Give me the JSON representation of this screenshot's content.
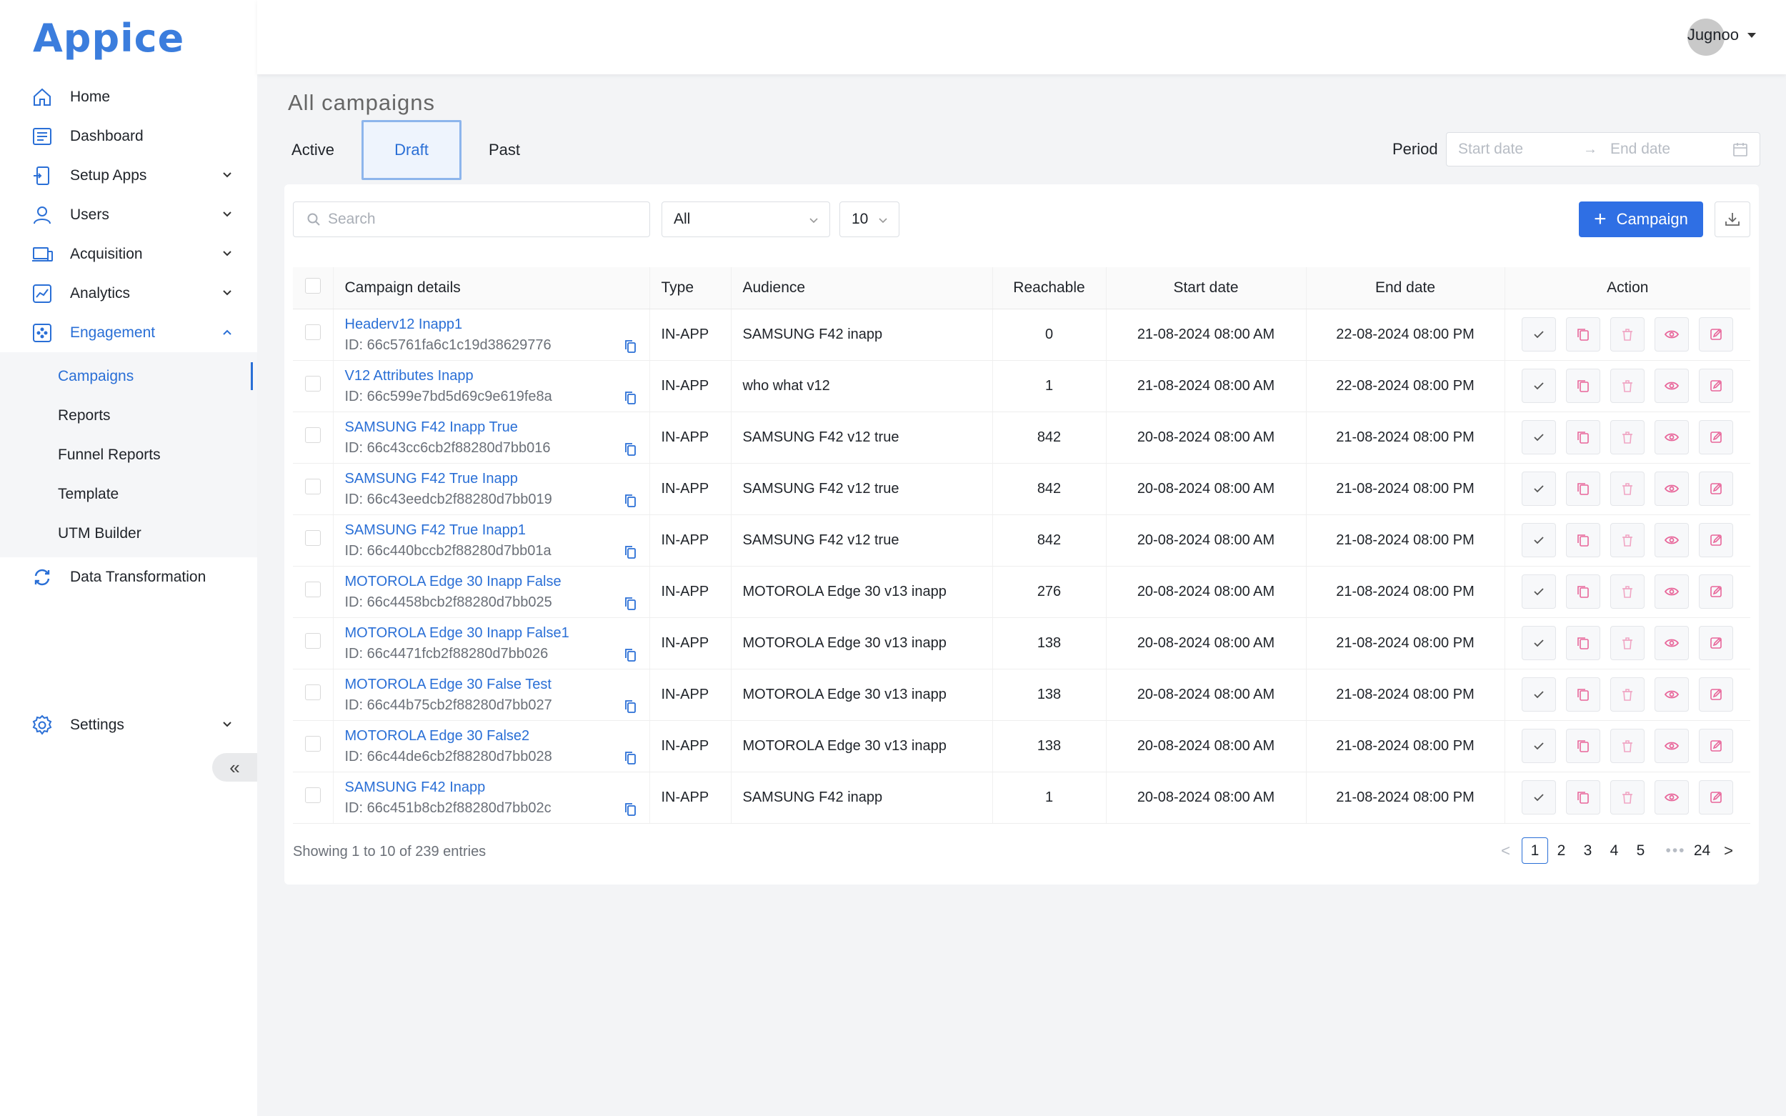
{
  "app": {
    "logo": "Appice"
  },
  "user": {
    "name": "Jugnoo"
  },
  "sidebar": {
    "items": [
      {
        "label": "Home",
        "icon": "home-icon"
      },
      {
        "label": "Dashboard",
        "icon": "dashboard-icon"
      },
      {
        "label": "Setup Apps",
        "icon": "setup-apps-icon"
      },
      {
        "label": "Users",
        "icon": "users-icon"
      },
      {
        "label": "Acquisition",
        "icon": "acquisition-icon"
      },
      {
        "label": "Analytics",
        "icon": "analytics-icon"
      },
      {
        "label": "Engagement",
        "icon": "engagement-icon"
      },
      {
        "label": "Data Transformation",
        "icon": "data-transformation-icon"
      },
      {
        "label": "Settings",
        "icon": "settings-icon"
      }
    ],
    "engagement_sub": [
      "Campaigns",
      "Reports",
      "Funnel Reports",
      "Template",
      "UTM Builder"
    ],
    "collapse_label": "«"
  },
  "page": {
    "title": "All campaigns",
    "tabs": [
      "Active",
      "Draft",
      "Past"
    ],
    "period_label": "Period",
    "start_placeholder": "Start date",
    "end_placeholder": "End date",
    "arrow": "→"
  },
  "toolbar": {
    "search_placeholder": "Search",
    "filter_value": "All",
    "page_size": "10",
    "add_label": "Campaign",
    "add_plus": "+"
  },
  "table": {
    "headers": [
      "Campaign details",
      "Type",
      "Audience",
      "Reachable",
      "Start date",
      "End date",
      "Action"
    ],
    "rows": [
      {
        "name": "Headerv12 Inapp1",
        "id": "ID: 66c5761fa6c1c19d38629776",
        "type": "IN-APP",
        "audience": "SAMSUNG F42 inapp",
        "reachable": "0",
        "start": "21-08-2024 08:00 AM",
        "end": "22-08-2024 08:00 PM"
      },
      {
        "name": "V12 Attributes Inapp",
        "id": "ID: 66c599e7bd5d69c9e619fe8a",
        "type": "IN-APP",
        "audience": "who what v12",
        "reachable": "1",
        "start": "21-08-2024 08:00 AM",
        "end": "22-08-2024 08:00 PM"
      },
      {
        "name": "SAMSUNG F42 Inapp True",
        "id": "ID: 66c43cc6cb2f88280d7bb016",
        "type": "IN-APP",
        "audience": "SAMSUNG F42 v12 true",
        "reachable": "842",
        "start": "20-08-2024 08:00 AM",
        "end": "21-08-2024 08:00 PM"
      },
      {
        "name": "SAMSUNG F42 True Inapp",
        "id": "ID: 66c43eedcb2f88280d7bb019",
        "type": "IN-APP",
        "audience": "SAMSUNG F42 v12 true",
        "reachable": "842",
        "start": "20-08-2024 08:00 AM",
        "end": "21-08-2024 08:00 PM"
      },
      {
        "name": "SAMSUNG F42 True Inapp1",
        "id": "ID: 66c440bccb2f88280d7bb01a",
        "type": "IN-APP",
        "audience": "SAMSUNG F42 v12 true",
        "reachable": "842",
        "start": "20-08-2024 08:00 AM",
        "end": "21-08-2024 08:00 PM"
      },
      {
        "name": "MOTOROLA Edge 30 Inapp False",
        "id": "ID: 66c4458bcb2f88280d7bb025",
        "type": "IN-APP",
        "audience": "MOTOROLA Edge 30 v13 inapp",
        "reachable": "276",
        "start": "20-08-2024 08:00 AM",
        "end": "21-08-2024 08:00 PM"
      },
      {
        "name": "MOTOROLA Edge 30 Inapp False1",
        "id": "ID: 66c4471fcb2f88280d7bb026",
        "type": "IN-APP",
        "audience": "MOTOROLA Edge 30 v13 inapp",
        "reachable": "138",
        "start": "20-08-2024 08:00 AM",
        "end": "21-08-2024 08:00 PM"
      },
      {
        "name": "MOTOROLA Edge 30 False Test",
        "id": "ID: 66c44b75cb2f88280d7bb027",
        "type": "IN-APP",
        "audience": "MOTOROLA Edge 30 v13 inapp",
        "reachable": "138",
        "start": "20-08-2024 08:00 AM",
        "end": "21-08-2024 08:00 PM"
      },
      {
        "name": "MOTOROLA Edge 30 False2",
        "id": "ID: 66c44de6cb2f88280d7bb028",
        "type": "IN-APP",
        "audience": "MOTOROLA Edge 30 v13 inapp",
        "reachable": "138",
        "start": "20-08-2024 08:00 AM",
        "end": "21-08-2024 08:00 PM"
      },
      {
        "name": "SAMSUNG F42 Inapp",
        "id": "ID: 66c451b8cb2f88280d7bb02c",
        "type": "IN-APP",
        "audience": "SAMSUNG F42 inapp",
        "reachable": "1",
        "start": "20-08-2024 08:00 AM",
        "end": "21-08-2024 08:00 PM"
      }
    ]
  },
  "footer": {
    "showing": "Showing 1 to 10 of 239 entries",
    "prev": "<",
    "pages": [
      "1",
      "2",
      "3",
      "4",
      "5"
    ],
    "dots": "•••",
    "last": "24",
    "next": ">"
  },
  "colors": {
    "accent": "#2a6fd6",
    "button": "#2f6fe4",
    "danger": "#e8669a"
  }
}
